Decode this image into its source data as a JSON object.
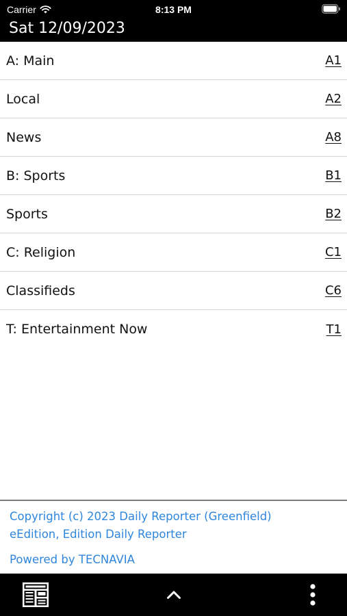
{
  "status_bar": {
    "carrier": "Carrier",
    "time": "8:13 PM"
  },
  "header": {
    "date": "Sat 12/09/2023"
  },
  "sections": [
    {
      "name": "A: Main",
      "page": "A1"
    },
    {
      "name": "Local",
      "page": "A2"
    },
    {
      "name": "News",
      "page": "A8"
    },
    {
      "name": "B: Sports",
      "page": "B1"
    },
    {
      "name": "Sports",
      "page": "B2"
    },
    {
      "name": "C: Religion",
      "page": "C1"
    },
    {
      "name": "Classifieds",
      "page": "C6"
    },
    {
      "name": "T: Entertainment Now",
      "page": "T1"
    }
  ],
  "footer": {
    "copyright_line1": "Copyright (c) 2023 Daily Reporter (Greenfield)",
    "copyright_line2": "eEdition, Edition Daily Reporter",
    "powered_by": "Powered by TECNAVIA",
    "link_color": "#2e86de"
  },
  "toolbar": {
    "icons": [
      "newspaper-icon",
      "chevron-up-icon",
      "more-vertical-icon"
    ]
  }
}
